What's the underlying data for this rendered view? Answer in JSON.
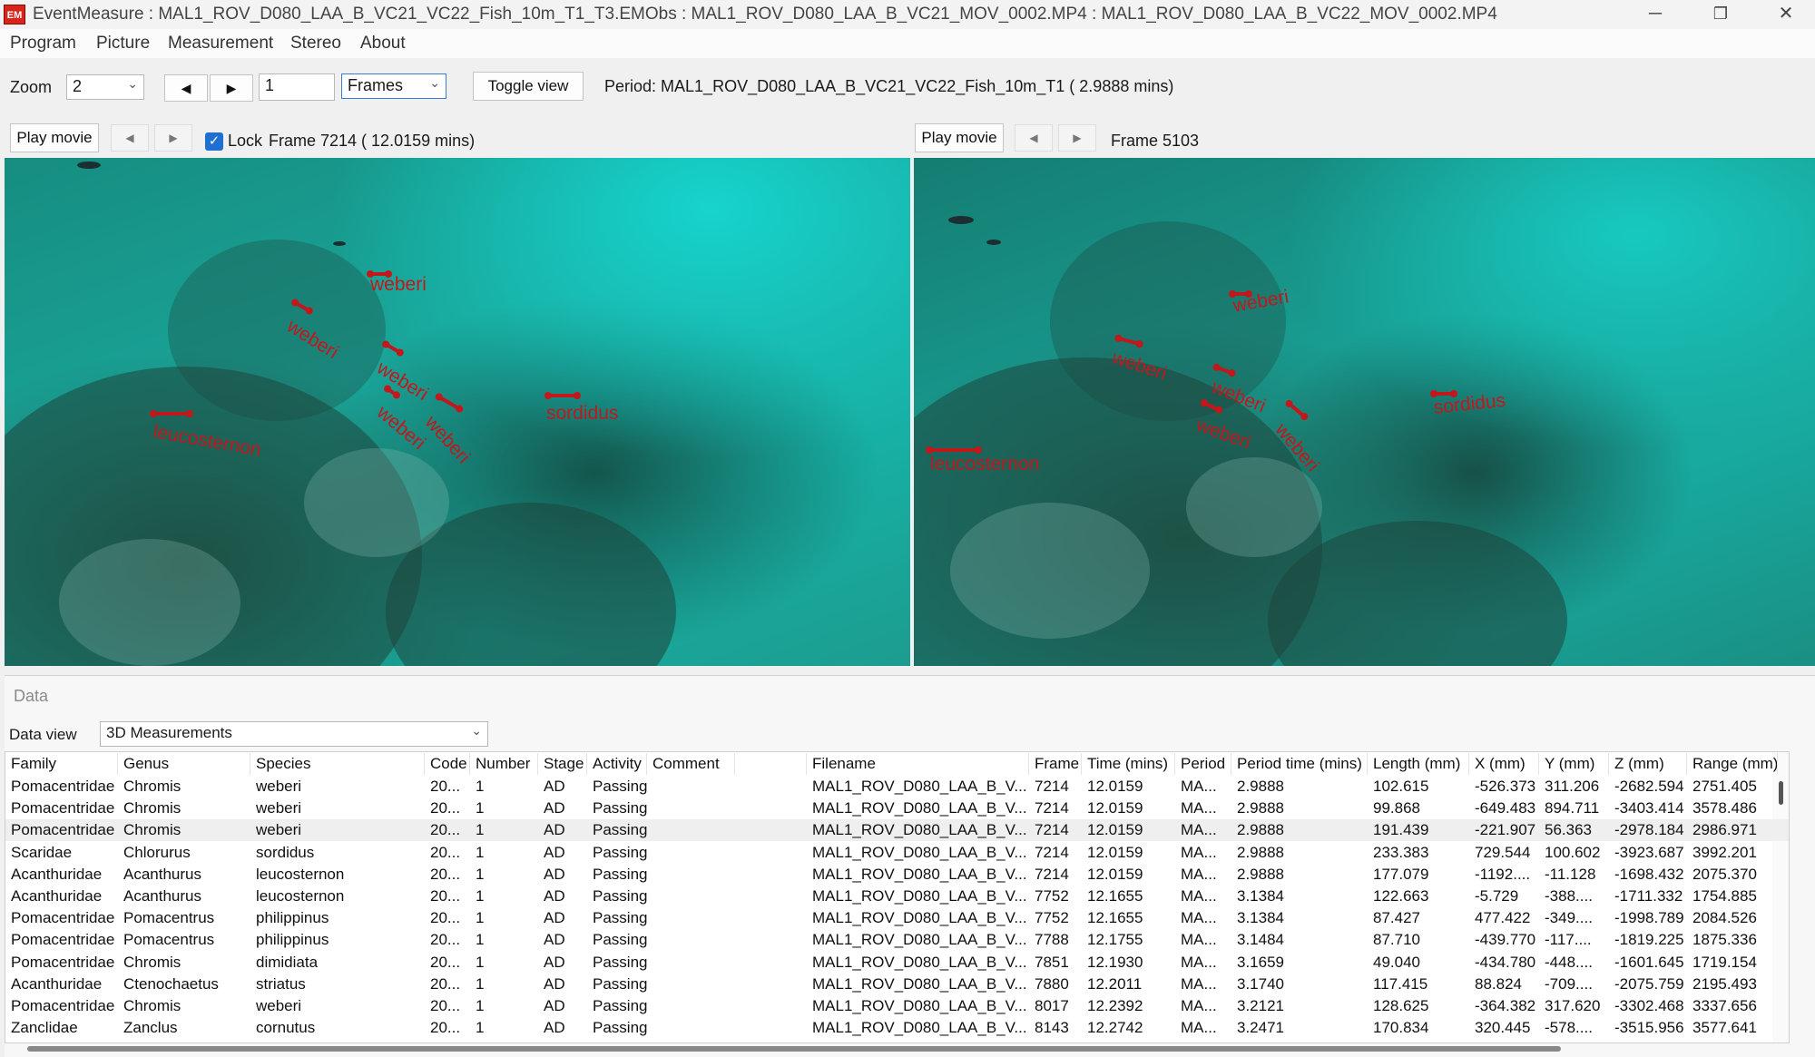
{
  "window": {
    "title": "EventMeasure : MAL1_ROV_D080_LAA_B_VC21_VC22_Fish_10m_T1_T3.EMObs : MAL1_ROV_D080_LAA_B_VC21_MOV_0002.MP4 : MAL1_ROV_D080_LAA_B_VC22_MOV_0002.MP4",
    "icon_text": "EM",
    "controls": {
      "minimize": "─",
      "restore": "❐",
      "close": "✕"
    }
  },
  "menu": [
    "Program",
    "Picture",
    "Measurement",
    "Stereo",
    "About"
  ],
  "toolbar": {
    "zoom_label": "Zoom",
    "zoom_value": "2",
    "prev_icon": "◀",
    "next_icon": "▶",
    "frame_input": "1",
    "units_value": "Frames",
    "toggle_label": "Toggle view",
    "period_text": "Period: MAL1_ROV_D080_LAA_B_VC21_VC22_Fish_10m_T1 (   2.9888 mins)"
  },
  "left_view": {
    "play_label": "Play movie",
    "prev_icon": "◀",
    "next_icon": "▶",
    "lock_label": "Lock",
    "lock_checked": true,
    "frame_text": "Frame 7214 (  12.0159 mins)",
    "labels": [
      "weberi",
      "weberi",
      "weberi",
      "weberi",
      "weberi",
      "sordidus",
      "leucosternon"
    ]
  },
  "right_view": {
    "play_label": "Play movie",
    "prev_icon": "◀",
    "next_icon": "▶",
    "frame_text": "Frame 5103",
    "labels": [
      "weberi",
      "weberi",
      "weberi",
      "weberi",
      "weberi",
      "sordidus",
      "leucosternon"
    ]
  },
  "data_panel": {
    "title": "Data",
    "view_label": "Data view",
    "view_value": "3D Measurements"
  },
  "table": {
    "columns": [
      "Family",
      "Genus",
      "Species",
      "Code",
      "Number",
      "Stage",
      "Activity",
      "Comment",
      "",
      "Filename",
      "Frame",
      "Time (mins)",
      "Period",
      "Period time (mins)",
      "Length (mm)",
      "X (mm)",
      "Y (mm)",
      "Z (mm)",
      "Range (mm)"
    ],
    "rows": [
      [
        "Pomacentridae",
        "Chromis",
        "weberi",
        "20...",
        "1",
        "AD",
        "Passing",
        "",
        "",
        "MAL1_ROV_D080_LAA_B_V...",
        "7214",
        "12.0159",
        "MA...",
        "2.9888",
        "102.615",
        "-526.373",
        "311.206",
        "-2682.594",
        "2751.405"
      ],
      [
        "Pomacentridae",
        "Chromis",
        "weberi",
        "20...",
        "1",
        "AD",
        "Passing",
        "",
        "",
        "MAL1_ROV_D080_LAA_B_V...",
        "7214",
        "12.0159",
        "MA...",
        "2.9888",
        "99.868",
        "-649.483",
        "894.711",
        "-3403.414",
        "3578.486"
      ],
      [
        "Pomacentridae",
        "Chromis",
        "weberi",
        "20...",
        "1",
        "AD",
        "Passing",
        "",
        "",
        "MAL1_ROV_D080_LAA_B_V...",
        "7214",
        "12.0159",
        "MA...",
        "2.9888",
        "191.439",
        "-221.907",
        "56.363",
        "-2978.184",
        "2986.971"
      ],
      [
        "Scaridae",
        "Chlorurus",
        "sordidus",
        "20...",
        "1",
        "AD",
        "Passing",
        "",
        "",
        "MAL1_ROV_D080_LAA_B_V...",
        "7214",
        "12.0159",
        "MA...",
        "2.9888",
        "233.383",
        "729.544",
        "100.602",
        "-3923.687",
        "3992.201"
      ],
      [
        "Acanthuridae",
        "Acanthurus",
        "leucosternon",
        "20...",
        "1",
        "AD",
        "Passing",
        "",
        "",
        "MAL1_ROV_D080_LAA_B_V...",
        "7214",
        "12.0159",
        "MA...",
        "2.9888",
        "177.079",
        "-1192....",
        "-11.128",
        "-1698.432",
        "2075.370"
      ],
      [
        "Acanthuridae",
        "Acanthurus",
        "leucosternon",
        "20...",
        "1",
        "AD",
        "Passing",
        "",
        "",
        "MAL1_ROV_D080_LAA_B_V...",
        "7752",
        "12.1655",
        "MA...",
        "3.1384",
        "122.663",
        "-5.729",
        "-388....",
        "-1711.332",
        "1754.885"
      ],
      [
        "Pomacentridae",
        "Pomacentrus",
        "philippinus",
        "20...",
        "1",
        "AD",
        "Passing",
        "",
        "",
        "MAL1_ROV_D080_LAA_B_V...",
        "7752",
        "12.1655",
        "MA...",
        "3.1384",
        "87.427",
        "477.422",
        "-349....",
        "-1998.789",
        "2084.526"
      ],
      [
        "Pomacentridae",
        "Pomacentrus",
        "philippinus",
        "20...",
        "1",
        "AD",
        "Passing",
        "",
        "",
        "MAL1_ROV_D080_LAA_B_V...",
        "7788",
        "12.1755",
        "MA...",
        "3.1484",
        "87.710",
        "-439.770",
        "-117....",
        "-1819.225",
        "1875.336"
      ],
      [
        "Pomacentridae",
        "Chromis",
        "dimidiata",
        "20...",
        "1",
        "AD",
        "Passing",
        "",
        "",
        "MAL1_ROV_D080_LAA_B_V...",
        "7851",
        "12.1930",
        "MA...",
        "3.1659",
        "49.040",
        "-434.780",
        "-448....",
        "-1601.645",
        "1719.154"
      ],
      [
        "Acanthuridae",
        "Ctenochaetus",
        "striatus",
        "20...",
        "1",
        "AD",
        "Passing",
        "",
        "",
        "MAL1_ROV_D080_LAA_B_V...",
        "7880",
        "12.2011",
        "MA...",
        "3.1740",
        "117.415",
        "88.824",
        "-709....",
        "-2075.759",
        "2195.493"
      ],
      [
        "Pomacentridae",
        "Chromis",
        "weberi",
        "20...",
        "1",
        "AD",
        "Passing",
        "",
        "",
        "MAL1_ROV_D080_LAA_B_V...",
        "8017",
        "12.2392",
        "MA...",
        "3.2121",
        "128.625",
        "-364.382",
        "317.620",
        "-3302.468",
        "3337.656"
      ],
      [
        "Zanclidae",
        "Zanclus",
        "cornutus",
        "20...",
        "1",
        "AD",
        "Passing",
        "",
        "",
        "MAL1_ROV_D080_LAA_B_V...",
        "8143",
        "12.2742",
        "MA...",
        "3.2471",
        "170.834",
        "320.445",
        "-578....",
        "-3515.956",
        "3577.641"
      ]
    ]
  }
}
